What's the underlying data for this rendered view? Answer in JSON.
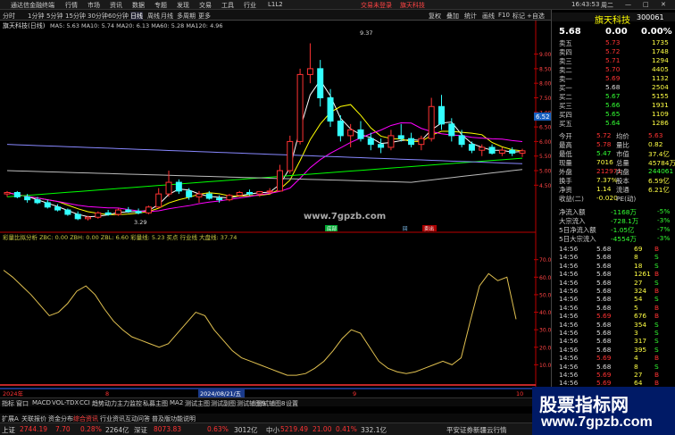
{
  "titlebar": {
    "app": "通达信金融终端",
    "menus": [
      "行情",
      "市场",
      "资讯",
      "数据",
      "专题",
      "发现",
      "交易",
      "工具",
      "行业",
      "L1L2"
    ],
    "center": "交易未登录",
    "center2": "旗天科技",
    "time": "16:43:53",
    "weekday": "周二"
  },
  "toolbar": {
    "items": [
      "分时",
      "1分钟",
      "5分钟",
      "15分钟",
      "30分钟",
      "60分钟",
      "日线",
      "周线",
      "月线",
      "多周期",
      "更多"
    ],
    "right": [
      "复权",
      "叠加",
      "统计",
      "画线",
      "F10",
      "标记",
      "+自选",
      "返回"
    ]
  },
  "chart": {
    "stock_line": "旗天科技(日线)",
    "ma_line": "MA5: 5.63  MA10: 5.74  MA20: 6.13  MA60: 5.28  MA120: 4.96",
    "ma_colors": {
      "ma5": "#ffffff",
      "ma10": "#ffff00",
      "ma20": "#ff00ff",
      "ma60": "#00ff00",
      "ma120": "#8888ff"
    },
    "high_label": "9.37",
    "low_label": "3.29",
    "y_labels": [
      "9.00",
      "8.50",
      "8.00",
      "7.50",
      "7.00",
      "6.50",
      "6.00",
      "5.50",
      "5.00",
      "4.50"
    ],
    "price_tag": "6.52",
    "watermark_text": "www.7gpzb.com",
    "signals": [
      "底部",
      "回",
      "卖出"
    ],
    "ind_line": "彩量比拟分析  ZBC: 0.00  ZBH: 0.00  ZBL: 6.60  彩量线: 5.23  买点  行业线  大盘线: 37.74",
    "ind_y": [
      "70.00",
      "60.00",
      "50.00",
      "40.00",
      "30.00",
      "20.00",
      "10.00"
    ],
    "date_labels": [
      "2024年",
      "8",
      "2024/08/21/五",
      "9",
      "10"
    ],
    "candles": [
      [
        4.2,
        4.3,
        4.1,
        4.25
      ],
      [
        4.25,
        4.3,
        4.05,
        4.1
      ],
      [
        4.1,
        4.2,
        3.9,
        4.0
      ],
      [
        4.0,
        4.1,
        3.85,
        3.9
      ],
      [
        3.9,
        4.0,
        3.7,
        3.75
      ],
      [
        3.75,
        3.85,
        3.6,
        3.65
      ],
      [
        3.65,
        3.7,
        3.45,
        3.5
      ],
      [
        3.5,
        3.6,
        3.3,
        3.35
      ],
      [
        3.35,
        3.45,
        3.29,
        3.4
      ],
      [
        3.4,
        3.6,
        3.35,
        3.55
      ],
      [
        3.55,
        3.65,
        3.45,
        3.5
      ],
      [
        3.5,
        3.7,
        3.45,
        3.65
      ],
      [
        3.65,
        3.75,
        3.55,
        3.6
      ],
      [
        3.6,
        3.7,
        3.5,
        3.55
      ],
      [
        3.55,
        3.8,
        3.5,
        3.75
      ],
      [
        3.75,
        4.4,
        3.7,
        4.2
      ],
      [
        4.2,
        5.0,
        4.1,
        4.6
      ],
      [
        4.6,
        4.7,
        4.2,
        4.3
      ],
      [
        4.3,
        4.4,
        4.0,
        4.1
      ],
      [
        4.1,
        4.3,
        3.9,
        4.2
      ],
      [
        4.2,
        4.3,
        4.0,
        4.05
      ],
      [
        4.05,
        4.15,
        3.9,
        4.0
      ],
      [
        4.0,
        4.2,
        3.95,
        4.15
      ],
      [
        4.15,
        4.3,
        4.1,
        4.25
      ],
      [
        4.25,
        4.35,
        4.15,
        4.2
      ],
      [
        4.2,
        4.3,
        4.1,
        4.28
      ],
      [
        4.28,
        4.4,
        4.2,
        4.3
      ],
      [
        4.3,
        5.2,
        4.3,
        5.0
      ],
      [
        5.0,
        6.2,
        4.9,
        6.0
      ],
      [
        6.0,
        8.5,
        5.9,
        8.3
      ],
      [
        8.3,
        9.37,
        8.0,
        8.5
      ],
      [
        8.5,
        8.8,
        7.2,
        7.5
      ],
      [
        7.5,
        7.8,
        6.5,
        6.7
      ],
      [
        6.7,
        6.9,
        6.0,
        6.2
      ],
      [
        6.2,
        6.6,
        5.8,
        6.4
      ],
      [
        6.4,
        6.7,
        6.0,
        6.1
      ],
      [
        6.1,
        6.3,
        5.7,
        5.9
      ],
      [
        5.9,
        6.1,
        5.6,
        5.8
      ],
      [
        5.8,
        6.4,
        5.7,
        6.2
      ],
      [
        6.2,
        6.6,
        6.0,
        6.1
      ],
      [
        6.1,
        6.3,
        5.8,
        5.9
      ],
      [
        5.9,
        6.2,
        5.7,
        6.1
      ],
      [
        6.1,
        7.5,
        6.0,
        7.2
      ],
      [
        7.2,
        7.6,
        6.4,
        6.6
      ],
      [
        6.6,
        6.8,
        6.0,
        6.2
      ],
      [
        6.2,
        6.4,
        5.8,
        5.9
      ],
      [
        5.9,
        6.0,
        5.6,
        5.7
      ],
      [
        5.7,
        5.9,
        5.5,
        5.8
      ],
      [
        5.8,
        5.9,
        5.55,
        5.6
      ],
      [
        5.6,
        5.8,
        5.5,
        5.7
      ],
      [
        5.7,
        5.8,
        5.5,
        5.6
      ],
      [
        5.6,
        5.75,
        5.47,
        5.68
      ]
    ],
    "ind_series": [
      64,
      60,
      55,
      50,
      44,
      38,
      40,
      45,
      52,
      55,
      50,
      42,
      35,
      30,
      26,
      24,
      22,
      20,
      22,
      28,
      34,
      40,
      38,
      30,
      24,
      18,
      14,
      12,
      10,
      8,
      6,
      4,
      4,
      5,
      8,
      12,
      18,
      25,
      30,
      28,
      20,
      12,
      8,
      6,
      5,
      6,
      8,
      10,
      12,
      10,
      14,
      35,
      55,
      62,
      58,
      60,
      36
    ]
  },
  "right_panel": {
    "name": "旗天科技",
    "code": "300061",
    "price": "5.68",
    "change": "0.00",
    "pct": "0.00%",
    "asks": [
      [
        "卖五",
        "5.73",
        "1735"
      ],
      [
        "卖四",
        "5.72",
        "1748"
      ],
      [
        "卖三",
        "5.71",
        "1294"
      ],
      [
        "卖二",
        "5.70",
        "4405"
      ],
      [
        "卖一",
        "5.69",
        "1132"
      ]
    ],
    "bids": [
      [
        "买一",
        "5.68",
        "2504"
      ],
      [
        "买二",
        "5.67",
        "5155"
      ],
      [
        "买三",
        "5.66",
        "1931"
      ],
      [
        "买四",
        "5.65",
        "1109"
      ],
      [
        "买五",
        "5.64",
        "1286"
      ]
    ],
    "stats": [
      [
        "今开",
        "5.72",
        "均价",
        "5.63"
      ],
      [
        "最高",
        "5.78",
        "量比",
        "0.82"
      ],
      [
        "最低",
        "5.47",
        "市值",
        "37.4亿"
      ],
      [
        "现量",
        "7016",
        "总量",
        "45784万"
      ],
      [
        "外盘",
        "212971",
        "内盘",
        "244061"
      ],
      [
        "换手",
        "7.37%",
        "股本",
        "6.59亿"
      ],
      [
        "净资",
        "1.14",
        "流通",
        "6.21亿"
      ],
      [
        "收益(二)",
        "-0.020",
        "PE(动)",
        ""
      ]
    ],
    "flows": [
      [
        "净流入额",
        "-1168万",
        "-5%"
      ],
      [
        "大宗流入",
        "-728.1万",
        "-3%"
      ],
      [
        "5日净流入额",
        "-1.05亿",
        "-7%"
      ],
      [
        "5日大宗流入",
        "-4554万",
        "-3%"
      ]
    ],
    "ticks": [
      [
        "14:56",
        "5.68",
        "69",
        "B"
      ],
      [
        "14:56",
        "5.68",
        "8",
        "S"
      ],
      [
        "14:56",
        "5.68",
        "18",
        "S"
      ],
      [
        "14:56",
        "5.68",
        "1261",
        "B"
      ],
      [
        "14:56",
        "5.68",
        "27",
        "S"
      ],
      [
        "14:56",
        "5.68",
        "324",
        "B"
      ],
      [
        "14:56",
        "5.68",
        "54",
        "S"
      ],
      [
        "14:56",
        "5.68",
        "5",
        "B"
      ],
      [
        "14:56",
        "5.69",
        "676",
        "B"
      ],
      [
        "14:56",
        "5.68",
        "354",
        "S"
      ],
      [
        "14:56",
        "5.68",
        "3",
        "S"
      ],
      [
        "14:56",
        "5.68",
        "317",
        "S"
      ],
      [
        "14:56",
        "5.68",
        "395",
        "S"
      ],
      [
        "14:56",
        "5.69",
        "4",
        "B"
      ],
      [
        "14:56",
        "5.68",
        "8",
        "S"
      ],
      [
        "14:56",
        "5.69",
        "27",
        "B"
      ],
      [
        "14:56",
        "5.69",
        "64",
        "B"
      ],
      [
        "14:56",
        "5.69",
        "22",
        "B"
      ],
      [
        "14:56",
        "5.69",
        "125",
        "B"
      ]
    ],
    "colors": {
      "up": "#ff3333",
      "down": "#33ff33",
      "neutral": "#dddddd",
      "label": "#cccccc"
    }
  },
  "bottom_tabs": [
    "指标",
    "窗口",
    "MACD",
    "VOL-TDX",
    "CCI",
    "趋势动力",
    "主力监控",
    "私募主图",
    "MA2",
    "测试主图",
    "测试副图",
    "测试辅图9",
    "测试辅图8",
    "设置"
  ],
  "bottom_tabs2": [
    "扩展A",
    "关联报价",
    "资金分布",
    "综合资讯",
    "行业资讯",
    "互动问答",
    "普及版功能说明"
  ],
  "statusbar": [
    [
      "上证",
      "2744.19",
      "7.70",
      "0.28%",
      "2264亿"
    ],
    [
      "深证",
      "8073.83",
      "0.63%",
      "3012亿"
    ],
    [
      "中小",
      "5219.49",
      "21.00",
      "0.41%",
      "332.1亿"
    ]
  ],
  "status_right": "平安证券新疆云行情",
  "wm": {
    "top": "股票指标网",
    "bottom": "www.7gpzb.com"
  }
}
